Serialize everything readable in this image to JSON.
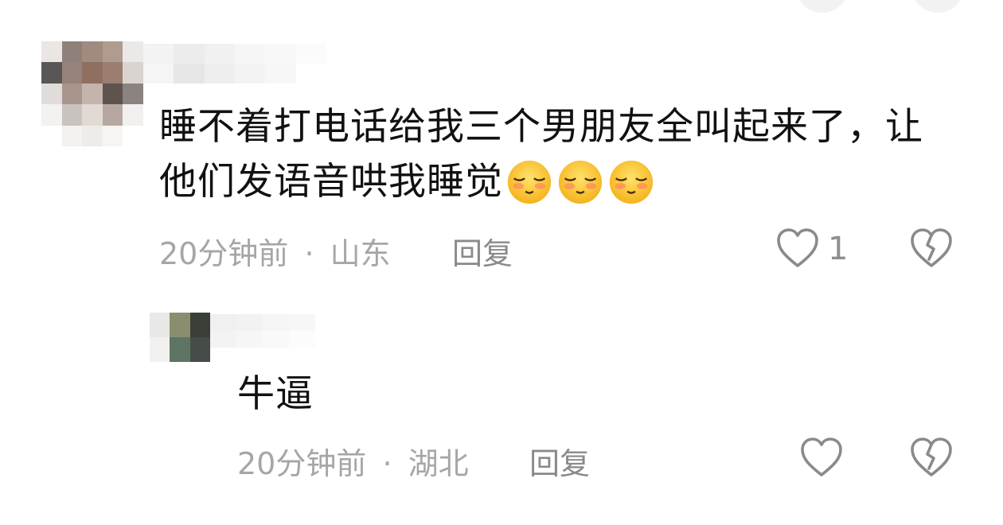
{
  "comments": [
    {
      "avatar_alt": "avatar",
      "username": "",
      "body": "睡不着打电话给我三个男朋友全叫起来了，让",
      "body_line2": "他们发语音哄我睡觉",
      "emojis": [
        "shy-emoji",
        "shy-emoji",
        "shy-emoji"
      ],
      "time": "20分钟前",
      "separator": "·",
      "location": "山东",
      "reply_label": "回复",
      "like_count": "1"
    },
    {
      "avatar_alt": "avatar",
      "username": "",
      "body": "牛逼",
      "time": "20分钟前",
      "separator": "·",
      "location": "湖北",
      "reply_label": "回复",
      "like_count": ""
    }
  ],
  "icons": {
    "like": "heart-outline-icon",
    "dislike": "broken-heart-icon"
  },
  "colors": {
    "text": "#111111",
    "meta": "#a6a6a6",
    "icon": "#8a8a8a"
  }
}
